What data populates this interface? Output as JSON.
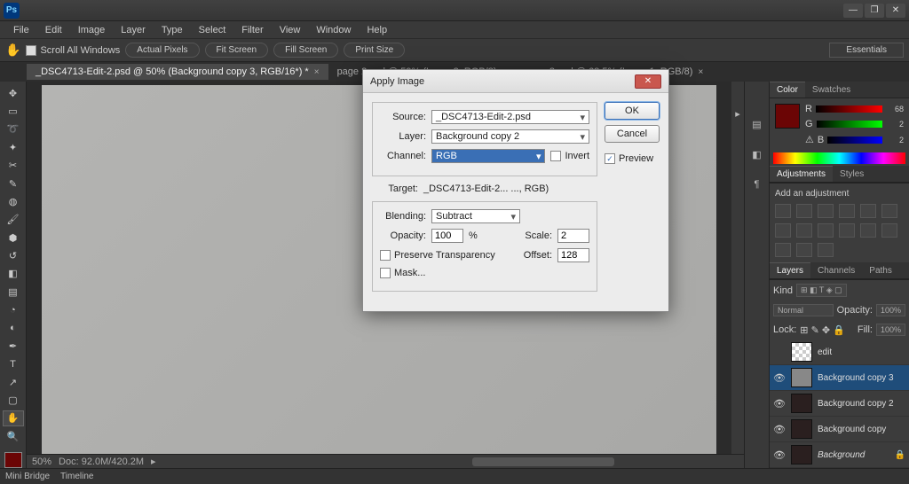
{
  "app": {
    "logo": "Ps"
  },
  "window_buttons": {
    "min": "—",
    "max": "❐",
    "close": "✕"
  },
  "menu": [
    "File",
    "Edit",
    "Image",
    "Layer",
    "Type",
    "Select",
    "Filter",
    "View",
    "Window",
    "Help"
  ],
  "options": {
    "scroll_all": "Scroll All Windows",
    "actual_pixels": "Actual Pixels",
    "fit_screen": "Fit Screen",
    "fill_screen": "Fill Screen",
    "print_size": "Print Size",
    "workspace": "Essentials"
  },
  "tabs": [
    {
      "label": "_DSC4713-Edit-2.psd @ 50% (Background copy 3, RGB/16*) *"
    },
    {
      "label": "page 2.psd @ 59% (Layer 2, RGB/8)"
    },
    {
      "label": "page 3.psd @ 68.5% (Layer 1, RGB/8)"
    }
  ],
  "status": {
    "zoom": "50%",
    "doc": "Doc: 92.0M/420.2M"
  },
  "bottom_tabs": {
    "mini": "Mini Bridge",
    "timeline": "Timeline"
  },
  "color": {
    "r_label": "R",
    "g_label": "G",
    "b_label": "B",
    "warn": "⚠",
    "r": "68",
    "g": "2",
    "b": "2",
    "tab_color": "Color",
    "tab_swatches": "Swatches"
  },
  "adjustments": {
    "tab_adj": "Adjustments",
    "tab_styles": "Styles",
    "title": "Add an adjustment"
  },
  "layers": {
    "tab_layers": "Layers",
    "tab_channels": "Channels",
    "tab_paths": "Paths",
    "kind": "Kind",
    "blend": "Normal",
    "opacity_lbl": "Opacity:",
    "opacity": "100%",
    "lock_lbl": "Lock:",
    "fill_lbl": "Fill:",
    "fill": "100%",
    "items": [
      {
        "name": "edit",
        "eye": ""
      },
      {
        "name": "Background copy 3",
        "eye": "👁"
      },
      {
        "name": "Background copy 2",
        "eye": "👁"
      },
      {
        "name": "Background copy",
        "eye": "👁"
      },
      {
        "name": "Background",
        "eye": "👁",
        "locked": true,
        "italic": true
      }
    ]
  },
  "dialog": {
    "title": "Apply Image",
    "source_lbl": "Source:",
    "source": "_DSC4713-Edit-2.psd",
    "layer_lbl": "Layer:",
    "layer": "Background copy 2",
    "channel_lbl": "Channel:",
    "channel": "RGB",
    "invert": "Invert",
    "target_lbl": "Target:",
    "target": "_DSC4713-Edit-2... ..., RGB)",
    "blending_lbl": "Blending:",
    "blending": "Subtract",
    "opacity_lbl": "Opacity:",
    "opacity": "100",
    "pct": "%",
    "scale_lbl": "Scale:",
    "scale": "2",
    "offset_lbl": "Offset:",
    "offset": "128",
    "preserve": "Preserve Transparency",
    "mask": "Mask...",
    "ok": "OK",
    "cancel": "Cancel",
    "preview": "Preview"
  }
}
